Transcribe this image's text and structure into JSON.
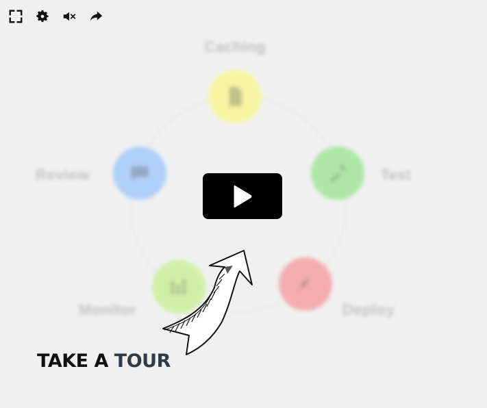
{
  "toolbar": {
    "items": [
      {
        "icon": "fullscreen-icon"
      },
      {
        "icon": "gear-icon"
      },
      {
        "icon": "mute-icon"
      },
      {
        "icon": "share-icon"
      }
    ]
  },
  "diagram": {
    "nodes": [
      {
        "label": "Caching",
        "color": "#f7f59a",
        "icon": "document-icon"
      },
      {
        "label": "Test",
        "color": "#a6e6a0",
        "icon": "wrench-icon"
      },
      {
        "label": "Deploy",
        "color": "#f5a6a6",
        "icon": "rocket-icon"
      },
      {
        "label": "Monitor",
        "color": "#cdef9e",
        "icon": "chart-icon"
      },
      {
        "label": "Review",
        "color": "#a9cdfa",
        "icon": "chat-icon"
      }
    ]
  },
  "play": {
    "icon": "play-icon",
    "background": "#000000"
  },
  "cta": {
    "part1": "TAKE A",
    "part2": "TOUR"
  }
}
